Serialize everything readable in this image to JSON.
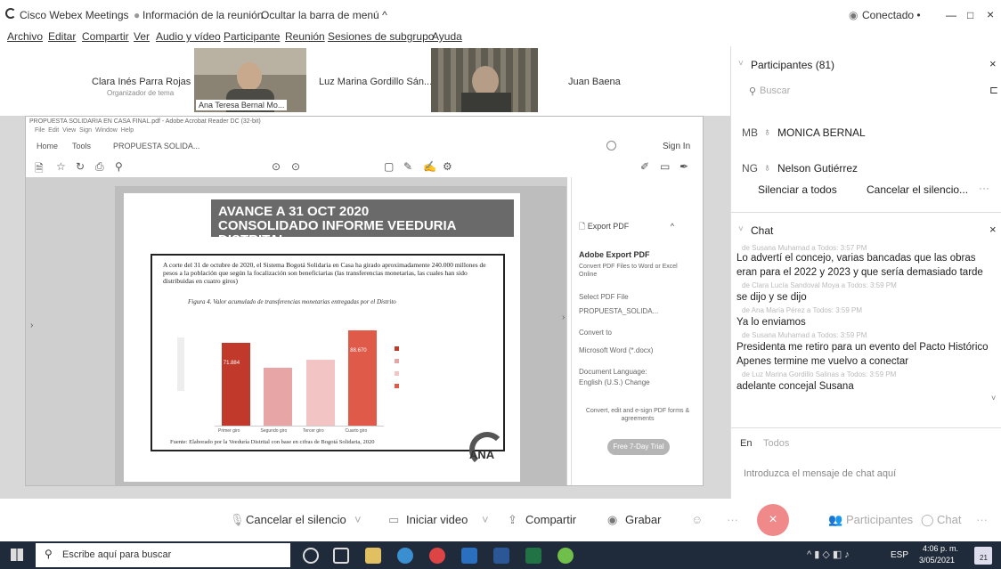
{
  "titlebar": {
    "app": "Cisco Webex Meetings",
    "info": "Información de la reunión",
    "hide": "Ocultar la barra de menú ^",
    "status": "Conectado •",
    "min": "—",
    "max": "□",
    "close": "×"
  },
  "menu": [
    "Archivo",
    "Editar",
    "Compartir",
    "Ver",
    "Audio y vídeo",
    "Participante",
    "Reunión",
    "Sesiones de subgrupo",
    "Ayuda"
  ],
  "videos": {
    "p1_name": "Clara Inés Parra Rojas",
    "p1_role": "Organizador de tema",
    "p2_label": "Ana Teresa Bernal Mo...",
    "p3_name": "Luz Marina Gordillo Sán...",
    "p5_name": "Juan Baena"
  },
  "acrobat": {
    "window_title": "PROPUESTA SOLIDARIA EN CASA FINAL.pdf - Adobe Acrobat Reader DC (32-bit)",
    "menu": "File  Edit  View  Sign  Window  Help",
    "tabs": [
      "Home",
      "Tools",
      "PROPUESTA SOLIDA..."
    ],
    "signin": "Sign In"
  },
  "slide": {
    "title_line1": "AVANCE A 31 OCT 2020",
    "title_line2": "CONSOLIDADO INFORME VEEDURIA DISTRITAL",
    "para": "A corte del 31 de octubre de 2020, el Sistema Bogotá Solidaria en Casa ha girado aproximadamente 240.000 millones de pesos a la población que según la focalización son beneficiarias (las transferencias monetarias, las cuales han sido distribuidas en cuatro giros)",
    "figcap": "Figura 4. Valor acumulado de transferencias monetarias entregadas por el Distrito",
    "footer": "Fuente: Elaborado por la Veeduría Distrital con base en cifras de Bogotá Solidaria, 2020",
    "logo": "ANA"
  },
  "chart_data": {
    "type": "bar",
    "categories": [
      "Primer giro",
      "Segundo giro",
      "Tercer giro",
      "Cuarto giro"
    ],
    "values": [
      71.8,
      50.1,
      56.7,
      82.5
    ],
    "value_labels": [
      "71.884",
      "",
      "",
      "88.670"
    ],
    "colors": [
      "#c0392b",
      "#e8a5a5",
      "#f2c4c4",
      "#e05a4a"
    ],
    "ylim": [
      0,
      100
    ]
  },
  "rpanel": {
    "export_head": "Export PDF",
    "title": "Adobe Export PDF",
    "desc": "Convert PDF Files to Word or Excel Online",
    "select_label": "Select PDF File",
    "file": "PROPUESTA_SOLIDA...",
    "convert_label": "Convert to",
    "format": "Microsoft Word (*.docx)",
    "lang_label": "Document Language:",
    "lang": "English (U.S.) Change",
    "promo": "Convert, edit and e-sign PDF forms & agreements",
    "trial_button": "Free 7-Day Trial"
  },
  "participants": {
    "header": "Participantes (81)",
    "search_placeholder": "Buscar",
    "rows": [
      {
        "initials": "MB",
        "name": "MONICA BERNAL"
      },
      {
        "initials": "NG",
        "name": "Nelson Gutiérrez"
      }
    ],
    "mute_all": "Silenciar a todos",
    "unmute_all": "Cancelar el silencio..."
  },
  "chat": {
    "header": "Chat",
    "messages": [
      {
        "meta": "de Susana Muhamad a Todos:  3:57 PM",
        "lines": [
          "Lo advertí el concejo, varias bancadas que las obras",
          "eran para el 2022 y 2023 y que sería demasiado tarde"
        ]
      },
      {
        "meta": "de Clara Lucía Sandoval Moya a Todos:  3:59 PM",
        "lines": [
          "se dijo y se dijo"
        ]
      },
      {
        "meta": "de Ana María Pérez a Todos:  3:59 PM",
        "lines": [
          "Ya lo enviamos"
        ]
      },
      {
        "meta": "de Susana Muhamad a Todos:  3:59 PM",
        "lines": [
          "Presidenta  me retiro para un evento del Pacto Histórico",
          "Apenes termine me vuelvo a conectar"
        ]
      },
      {
        "meta": "de Luz Marina Gordillo Salinas a Todos:  3:59 PM",
        "lines": [
          "adelante concejal Susana"
        ]
      }
    ],
    "to_label": "En",
    "to_value": "Todos",
    "input_placeholder": "Introduzca el mensaje de chat aquí"
  },
  "controls": {
    "unmute": "Cancelar el silencio",
    "video": "Iniciar video",
    "share": "Compartir",
    "record": "Grabar",
    "participants": "Participantes",
    "chat": "Chat"
  },
  "taskbar": {
    "search": "Escribe aquí para buscar",
    "lang": "ESP",
    "time": "4:06 p. m.",
    "date": "3/05/2021",
    "badge": "21"
  }
}
